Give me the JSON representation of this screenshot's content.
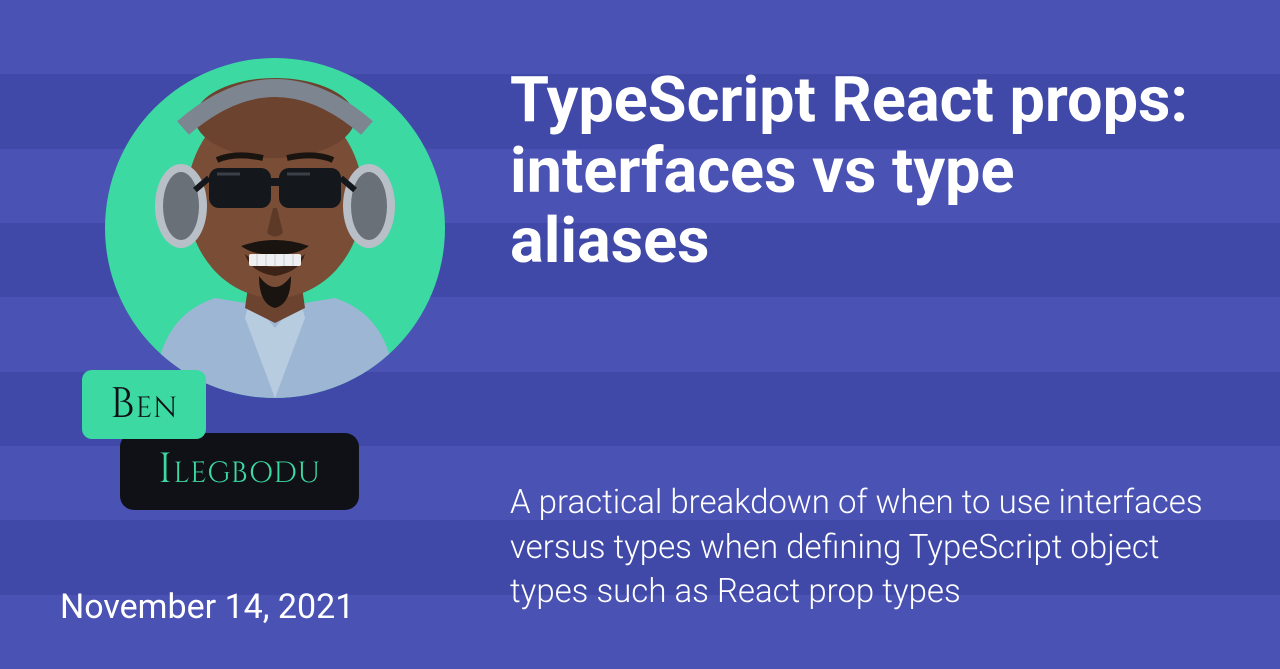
{
  "author": {
    "first_name": "Ben",
    "last_name": "Ilegbodu"
  },
  "date": "November 14, 2021",
  "title": "TypeScript React props: interfaces vs type aliases",
  "subtitle": "A practical breakdown of when to use interfaces versus types when defining TypeScript object types such as React prop types",
  "colors": {
    "accent": "#3dd9a3",
    "background": "#4a52b3",
    "stripe_dark": "#4049a8",
    "text": "#ffffff",
    "name_bg_dark": "#0f1116"
  }
}
